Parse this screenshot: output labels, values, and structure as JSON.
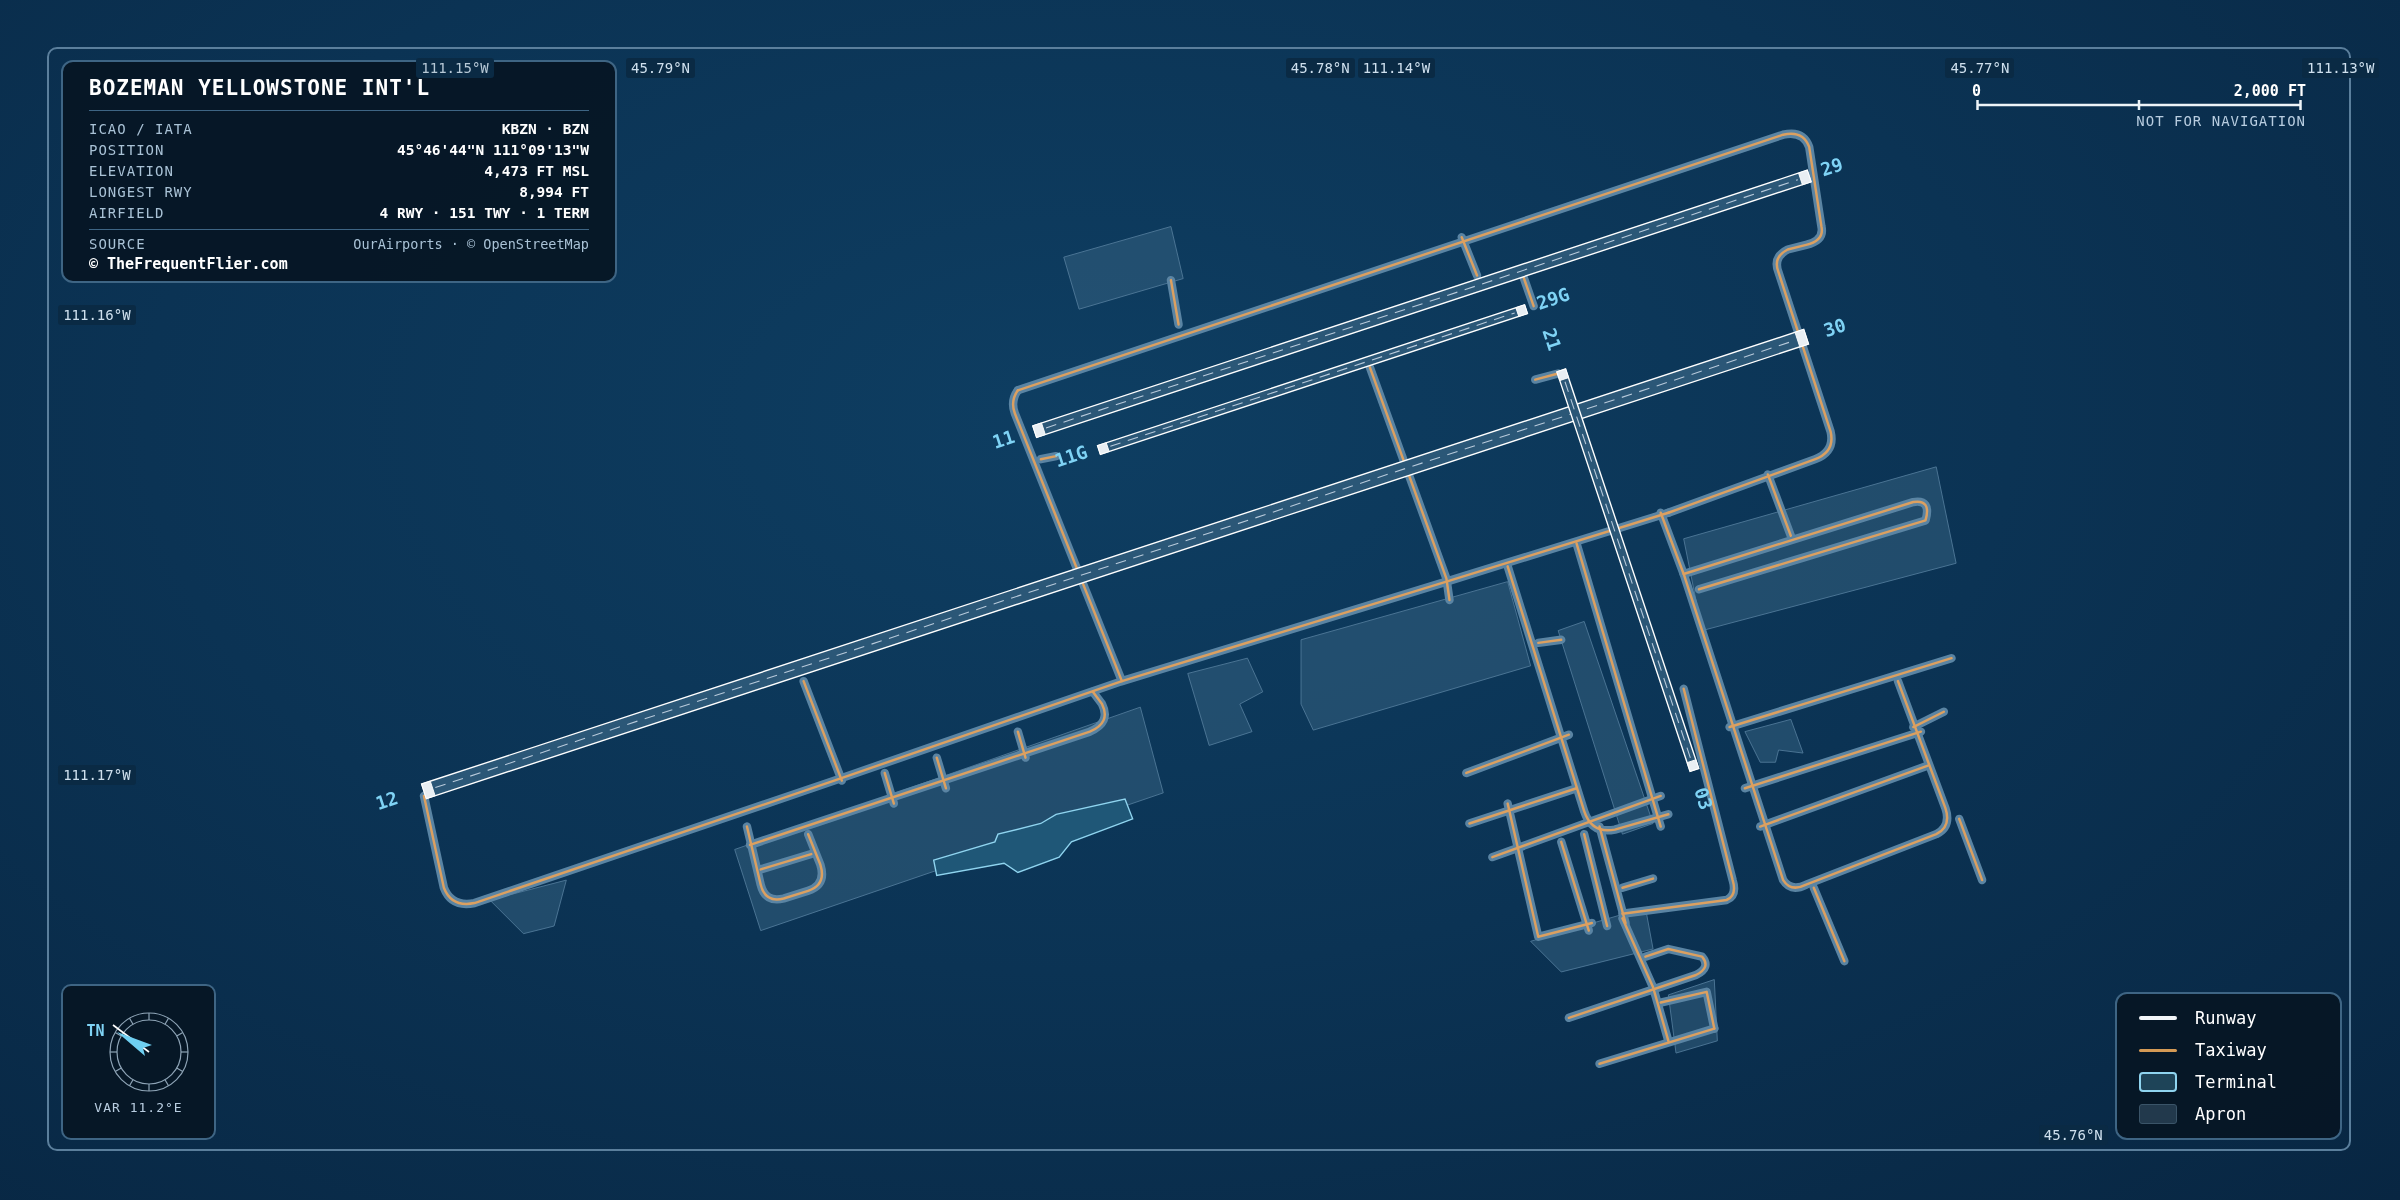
{
  "airport": {
    "name": "BOZEMAN YELLOWSTONE INT'L",
    "rows": [
      {
        "label": "ICAO / IATA",
        "value": "KBZN · BZN"
      },
      {
        "label": "POSITION",
        "value": "45°46'44\"N 111°09'13\"W"
      },
      {
        "label": "ELEVATION",
        "value": "4,473 FT MSL"
      },
      {
        "label": "LONGEST RWY",
        "value": "8,994 FT"
      },
      {
        "label": "AIRFIELD",
        "value": "4 RWY · 151 TWY · 1 TERM"
      }
    ],
    "source": {
      "label": "SOURCE",
      "value": "OurAirports · © OpenStreetMap"
    },
    "credit": "© TheFrequentFlier.com"
  },
  "grid_labels": [
    "111.15°W",
    "45.79°N",
    "45.78°N",
    "111.14°W",
    "45.77°N",
    "111.13°W",
    "111.16°W",
    "111.17°W",
    "45.76°N"
  ],
  "scale_bar": {
    "start": "0",
    "end": "2,000 FT",
    "note": "NOT FOR NAVIGATION"
  },
  "runways": [
    {
      "ends": [
        "11",
        "29"
      ]
    },
    {
      "ends": [
        "11G",
        "29G"
      ]
    },
    {
      "ends": [
        "12",
        "30"
      ]
    },
    {
      "ends": [
        "21",
        "03"
      ]
    }
  ],
  "compass": {
    "label": "TN",
    "variation": "VAR 11.2°E"
  },
  "legend": [
    {
      "kind": "runway",
      "label": "Runway"
    },
    {
      "kind": "taxiway",
      "label": "Taxiway"
    },
    {
      "kind": "terminal",
      "label": "Terminal"
    },
    {
      "kind": "apron",
      "label": "Apron"
    }
  ]
}
